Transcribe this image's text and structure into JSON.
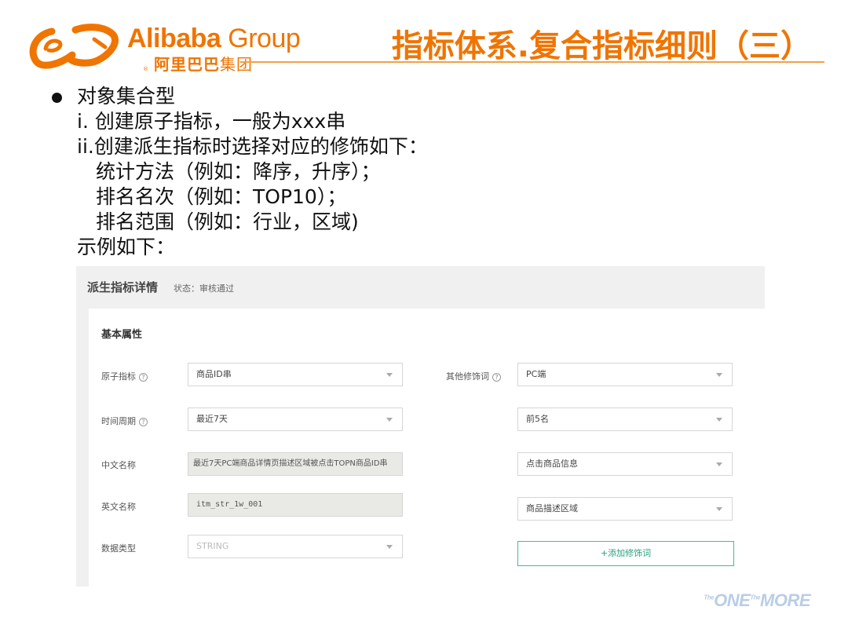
{
  "logo": {
    "brand": "Alibaba",
    "group": "Group",
    "cn_bold": "阿里巴巴",
    "cn_thin": "集团",
    "reg": "®"
  },
  "title": "指标体系.复合指标细则（三）",
  "body": {
    "lines": [
      "对象集合型",
      "i. 创建原子指标，一般为xxx串",
      "ii.创建派生指标时选择对应的修饰如下：",
      "统计方法（例如：降序，升序）；",
      "排名名次（例如：TOP10）；",
      "排名范围（例如：行业，区域)",
      "示例如下："
    ]
  },
  "screenshot": {
    "panel_title": "派生指标详情",
    "status": "状态：审核通过",
    "section_title": "基本属性",
    "left_fields": [
      {
        "label": "原子指标",
        "value": "商品ID串",
        "help": "?"
      },
      {
        "label": "时间周期",
        "value": "最近7天",
        "help": "?"
      },
      {
        "label": "中文名称",
        "value": "最近7天PC端商品详情页描述区域被点击TOPN商品ID串"
      },
      {
        "label": "英文名称",
        "value": "itm_str_1w_001"
      },
      {
        "label": "数据类型",
        "value": "STRING"
      }
    ],
    "right_label": "其他修饰词",
    "right_help": "?",
    "right_fields": [
      "PC端",
      "前5名",
      "点击商品信息",
      "商品描述区域"
    ],
    "add_button": "+添加修饰词"
  },
  "footer": {
    "the1": "The",
    "one": "ONE",
    "the2": "The",
    "more": "MORE"
  },
  "colors": {
    "brand_orange": "#f07400",
    "accent_green": "#3fbf9a"
  }
}
